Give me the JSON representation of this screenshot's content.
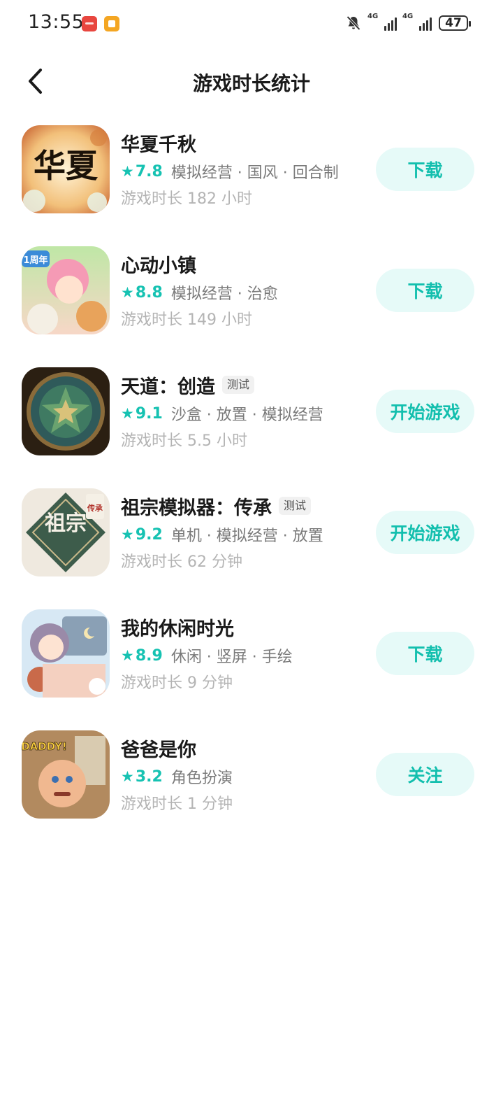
{
  "status_bar": {
    "time": "13:55",
    "network_1": "4G",
    "network_2": "4G",
    "battery": "47",
    "icons": [
      "huawei-app-icon",
      "orange-app-icon",
      "mute-bell-icon",
      "signal-icon",
      "signal-icon",
      "battery-icon"
    ]
  },
  "header": {
    "back_icon": "chevron-left-icon",
    "title": "游戏时长统计"
  },
  "colors": {
    "accent": "#16c2b2",
    "button_bg": "#e6faf8",
    "playtime_text": "#b4b4b4",
    "tag_text": "#7a7a7a"
  },
  "games": [
    {
      "name": "华夏千秋",
      "badge": "",
      "rating": "7.8",
      "tags": "模拟经营 · 国风 · 回合制",
      "playtime": "游戏时长 182 小时",
      "action": "下载",
      "thumb_text": "华夏"
    },
    {
      "name": "心动小镇",
      "badge": "",
      "rating": "8.8",
      "tags": "模拟经营 · 治愈",
      "playtime": "游戏时长 149 小时",
      "action": "下载",
      "thumb_text": "1周年"
    },
    {
      "name": "天道：创造",
      "badge": "测试",
      "rating": "9.1",
      "tags": "沙盒 · 放置 · 模拟经营",
      "playtime": "游戏时长 5.5 小时",
      "action": "开始游戏",
      "thumb_text": ""
    },
    {
      "name": "祖宗模拟器：传承",
      "badge": "测试",
      "rating": "9.2",
      "tags": "单机 · 模拟经营 · 放置",
      "playtime": "游戏时长 62 分钟",
      "action": "开始游戏",
      "thumb_text": "祖宗",
      "thumb_text_2": "传承"
    },
    {
      "name": "我的休闲时光",
      "badge": "",
      "rating": "8.9",
      "tags": "休闲 · 竖屏 · 手绘",
      "playtime": "游戏时长 9 分钟",
      "action": "下载",
      "thumb_text": ""
    },
    {
      "name": "爸爸是你",
      "badge": "",
      "rating": "3.2",
      "tags": "角色扮演",
      "playtime": "游戏时长 1 分钟",
      "action": "关注",
      "thumb_text": "DADDY!"
    }
  ]
}
